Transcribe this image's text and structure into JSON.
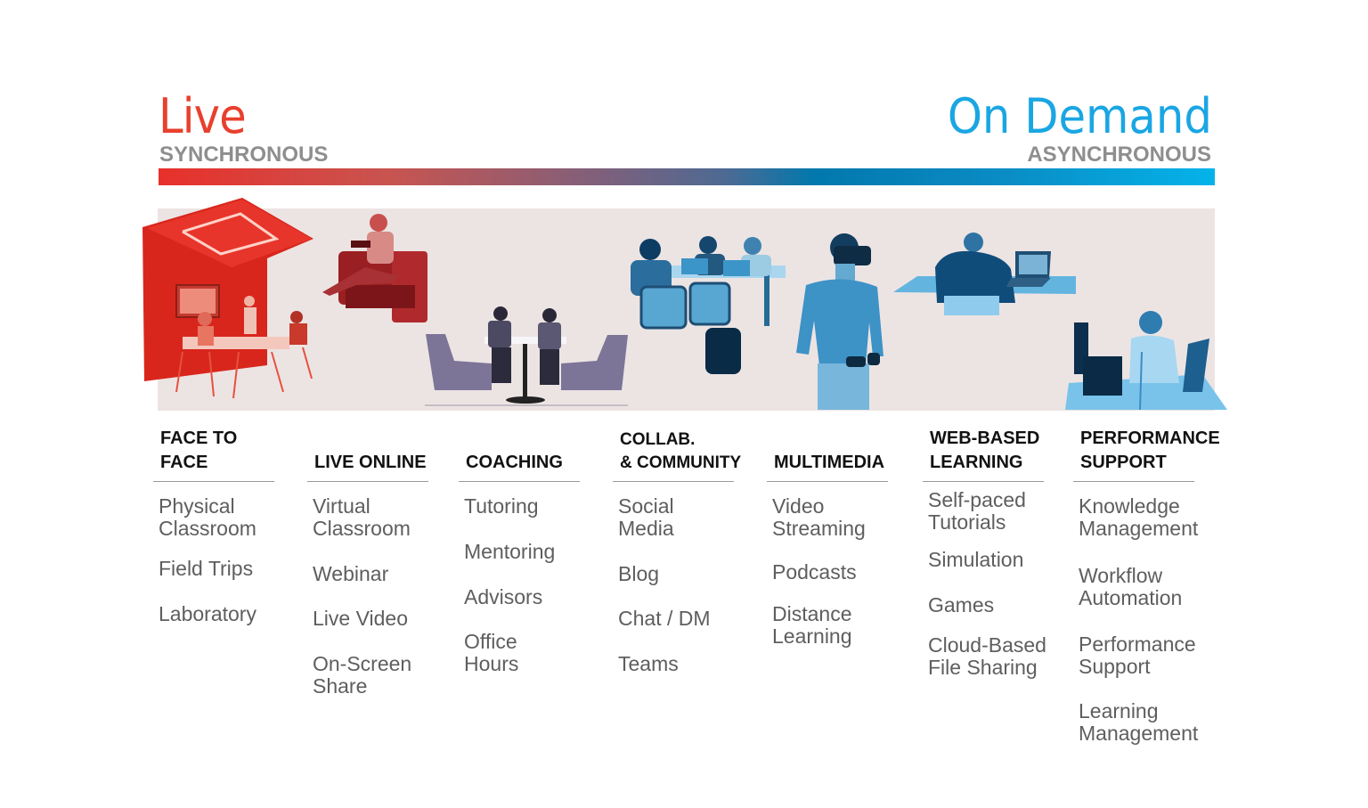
{
  "header": {
    "left_title": "Live",
    "left_subtitle": "SYNCHRONOUS",
    "right_title": "On Demand",
    "right_subtitle": "ASYNCHRONOUS",
    "left_color": "#e8402e",
    "right_color": "#1aa6e3"
  },
  "spectrum": {
    "start_color": "#e8302a",
    "end_color": "#04b3ea"
  },
  "illustrations": [
    {
      "name": "meeting-room-scene",
      "tint": "red"
    },
    {
      "name": "reader-armchair-scene",
      "tint": "red"
    },
    {
      "name": "coaching-booth-scene",
      "tint": "purple"
    },
    {
      "name": "group-laptops-scene",
      "tint": "blue"
    },
    {
      "name": "vr-headset-scene",
      "tint": "blue"
    },
    {
      "name": "laptop-desk-scene",
      "tint": "blue"
    },
    {
      "name": "headset-workstation-scene",
      "tint": "blue"
    }
  ],
  "columns": [
    {
      "heading": "FACE TO\nFACE",
      "items": [
        "Physical\nClassroom",
        "Field Trips",
        "Laboratory"
      ]
    },
    {
      "heading": "LIVE ONLINE",
      "items": [
        "Virtual\nClassroom",
        "Webinar",
        "Live Video",
        "On-Screen\nShare"
      ]
    },
    {
      "heading": "COACHING",
      "items": [
        "Tutoring",
        "Mentoring",
        "Advisors",
        "Office\nHours"
      ]
    },
    {
      "heading": "COLLAB.\n& COMMUNITY",
      "items": [
        "Social\nMedia",
        "Blog",
        "Chat / DM",
        "Teams"
      ]
    },
    {
      "heading": "MULTIMEDIA",
      "items": [
        "Video\nStreaming",
        "Podcasts",
        "Distance\nLearning"
      ]
    },
    {
      "heading": "WEB-BASED\nLEARNING",
      "items": [
        "Self-paced\nTutorials",
        "Simulation",
        "Games",
        "Cloud-Based\nFile Sharing"
      ]
    },
    {
      "heading": "PERFORMANCE\nSUPPORT",
      "items": [
        "Knowledge\nManagement",
        "Workflow\nAutomation",
        "Performance\nSupport",
        "Learning\nManagement"
      ]
    }
  ]
}
